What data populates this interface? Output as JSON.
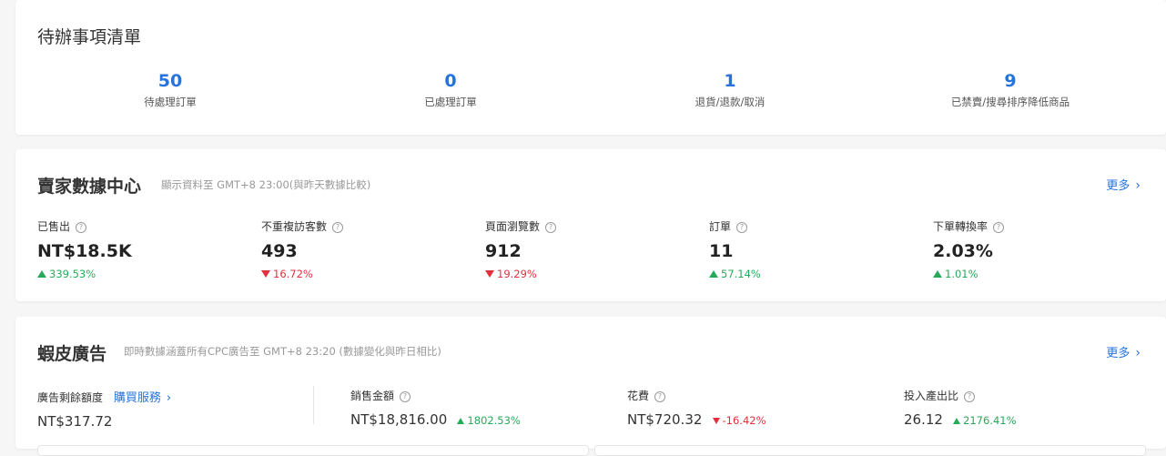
{
  "todo": {
    "title": "待辦事項清單",
    "items": [
      {
        "value": "50",
        "label": "待處理訂單"
      },
      {
        "value": "0",
        "label": "已處理訂單"
      },
      {
        "value": "1",
        "label": "退貨/退款/取消"
      },
      {
        "value": "9",
        "label": "已禁賣/搜尋排序降低商品"
      }
    ]
  },
  "data_center": {
    "title": "賣家數據中心",
    "subtitle": "顯示資料至 GMT+8 23:00(與昨天數據比較)",
    "more": "更多",
    "metrics": [
      {
        "label": "已售出",
        "value": "NT$18.5K",
        "change": "339.53%",
        "direction": "up"
      },
      {
        "label": "不重複訪客數",
        "value": "493",
        "change": "16.72%",
        "direction": "down"
      },
      {
        "label": "頁面瀏覽數",
        "value": "912",
        "change": "19.29%",
        "direction": "down"
      },
      {
        "label": "訂單",
        "value": "11",
        "change": "57.14%",
        "direction": "up"
      },
      {
        "label": "下單轉換率",
        "value": "2.03%",
        "change": "1.01%",
        "direction": "up"
      }
    ]
  },
  "ads": {
    "title": "蝦皮廣告",
    "subtitle": "即時數據涵蓋所有CPC廣告至 GMT+8 23:20 (數據變化與昨日相比)",
    "more": "更多",
    "balance": {
      "label": "廣告剩餘額度",
      "link": "購買服務",
      "value": "NT$317.72"
    },
    "metrics": [
      {
        "label": "銷售金額",
        "value": "NT$18,816.00",
        "change": "1802.53%",
        "direction": "up"
      },
      {
        "label": "花費",
        "value": "NT$720.32",
        "change": "-16.42%",
        "direction": "down"
      },
      {
        "label": "投入產出比",
        "value": "26.12",
        "change": "2176.41%",
        "direction": "up"
      }
    ]
  },
  "colors": {
    "accent": "#2673dd",
    "up": "#26aa5a",
    "down": "#e22f3f"
  },
  "icons": {
    "help": "question-circle-icon",
    "chevron": "chevron-right-icon"
  }
}
